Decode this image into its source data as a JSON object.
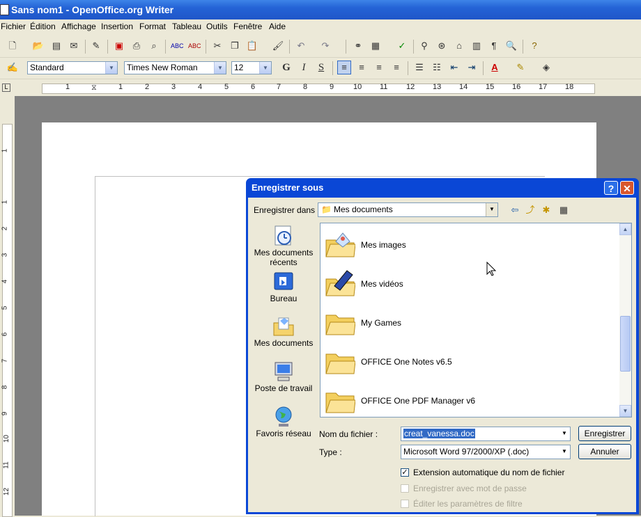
{
  "window": {
    "title": "Sans nom1 - OpenOffice.org Writer"
  },
  "menu": [
    "Fichier",
    "Édition",
    "Affichage",
    "Insertion",
    "Format",
    "Tableau",
    "Outils",
    "Fenêtre",
    "Aide"
  ],
  "format_bar": {
    "style": "Standard",
    "font": "Times New Roman",
    "size": "12",
    "bold": "G",
    "italic": "I",
    "underline": "S"
  },
  "ruler_numbers": [
    "1",
    "1",
    "2",
    "3",
    "4",
    "5",
    "6",
    "7",
    "8",
    "9",
    "10",
    "11",
    "12",
    "13",
    "14",
    "15",
    "16",
    "17",
    "18"
  ],
  "vruler_numbers": [
    "1",
    "1",
    "2",
    "3",
    "4",
    "5",
    "6",
    "7",
    "8",
    "9",
    "10",
    "11",
    "12"
  ],
  "dialog": {
    "title": "Enregistrer sous",
    "help_label": "?",
    "close_label": "✕",
    "save_in_label": "Enregistrer dans :",
    "save_in_value": "Mes documents",
    "places": [
      "Mes documents récents",
      "Bureau",
      "Mes documents",
      "Poste de travail",
      "Favoris réseau"
    ],
    "files": [
      "Mes images",
      "Mes vidéos",
      "My Games",
      "OFFICE One Notes v6.5",
      "OFFICE One PDF Manager v6"
    ],
    "filename_label": "Nom du fichier :",
    "filename_value": "creat_vanessa.doc",
    "type_label": "Type :",
    "type_value": "Microsoft Word 97/2000/XP (.doc)",
    "save_button": "Enregistrer",
    "cancel_button": "Annuler",
    "check_auto_ext": "Extension automatique du nom de fichier",
    "check_password": "Enregistrer avec mot de passe",
    "check_filter": "Éditer les paramètres de filtre"
  }
}
